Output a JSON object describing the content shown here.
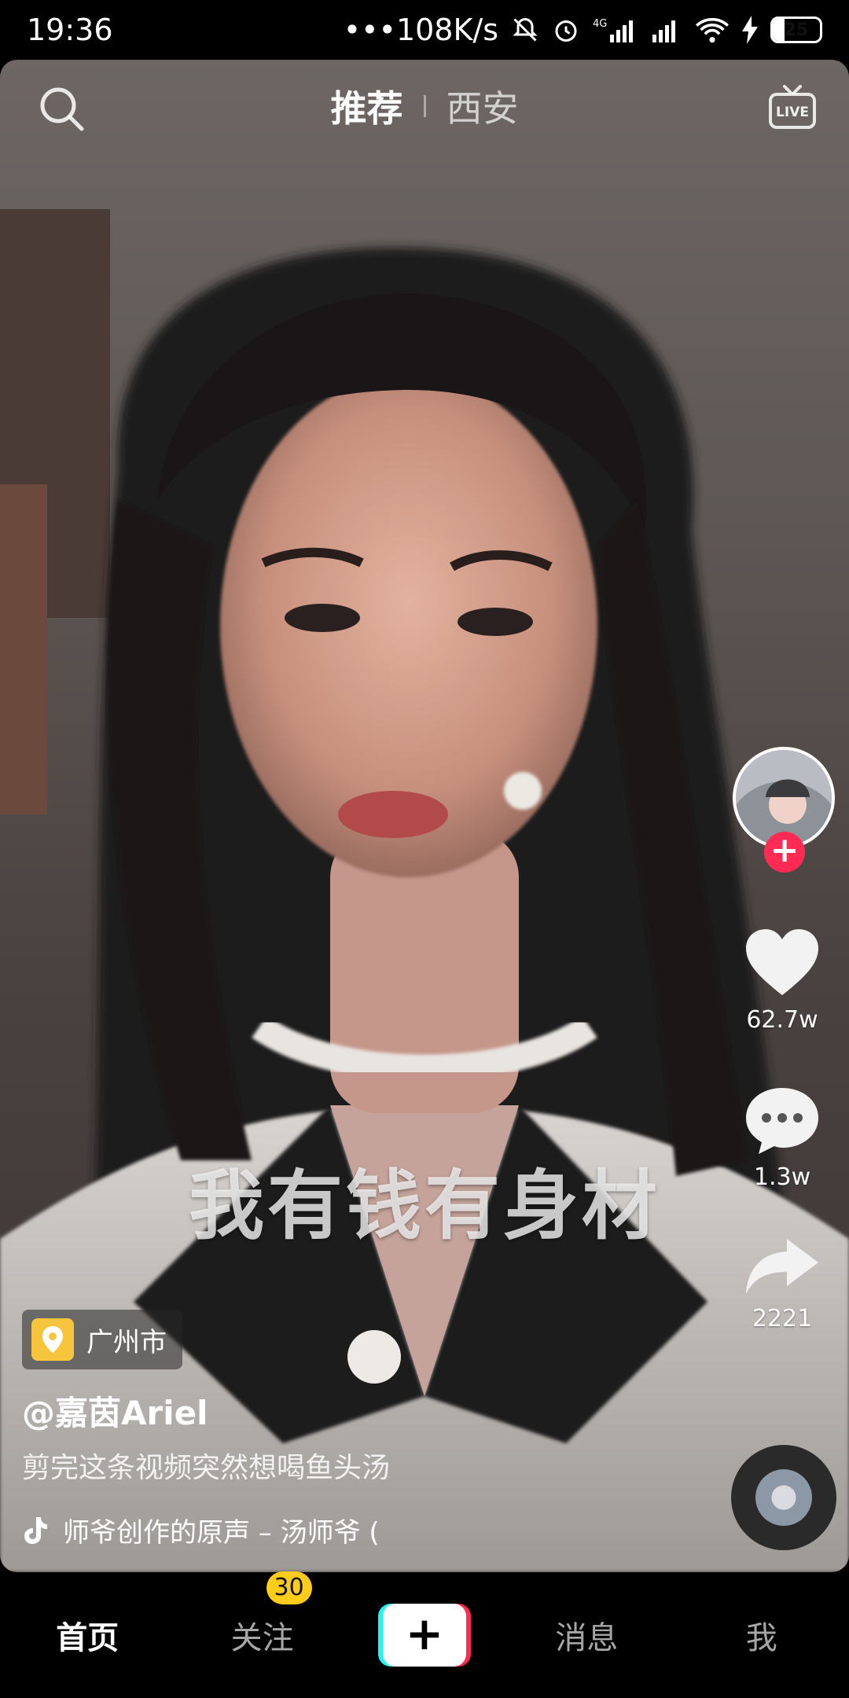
{
  "status_bar": {
    "time": "19:36",
    "net_speed": "•••108K/s",
    "network_label": "4G",
    "battery": "25"
  },
  "top": {
    "tab_active": "推荐",
    "tab_inactive": "西安",
    "live_label": "LIVE"
  },
  "video": {
    "subtitle": "我有钱有身材",
    "location": "广州市",
    "username": "@嘉茵Ariel",
    "caption": "剪完这条视频突然想喝鱼头汤",
    "music": "师爷创作的原声 – 汤师爷   ("
  },
  "actions": {
    "likes": "62.7w",
    "comments": "1.3w",
    "shares": "2221"
  },
  "nav": {
    "home": "首页",
    "following": "关注",
    "following_badge": "30",
    "create": "+",
    "messages": "消息",
    "me": "我"
  },
  "colors": {
    "accent_red": "#fe2c55",
    "accent_cyan": "#25f4ee",
    "badge_yellow": "#ffcc1a",
    "location_yellow": "#f7c53d"
  }
}
